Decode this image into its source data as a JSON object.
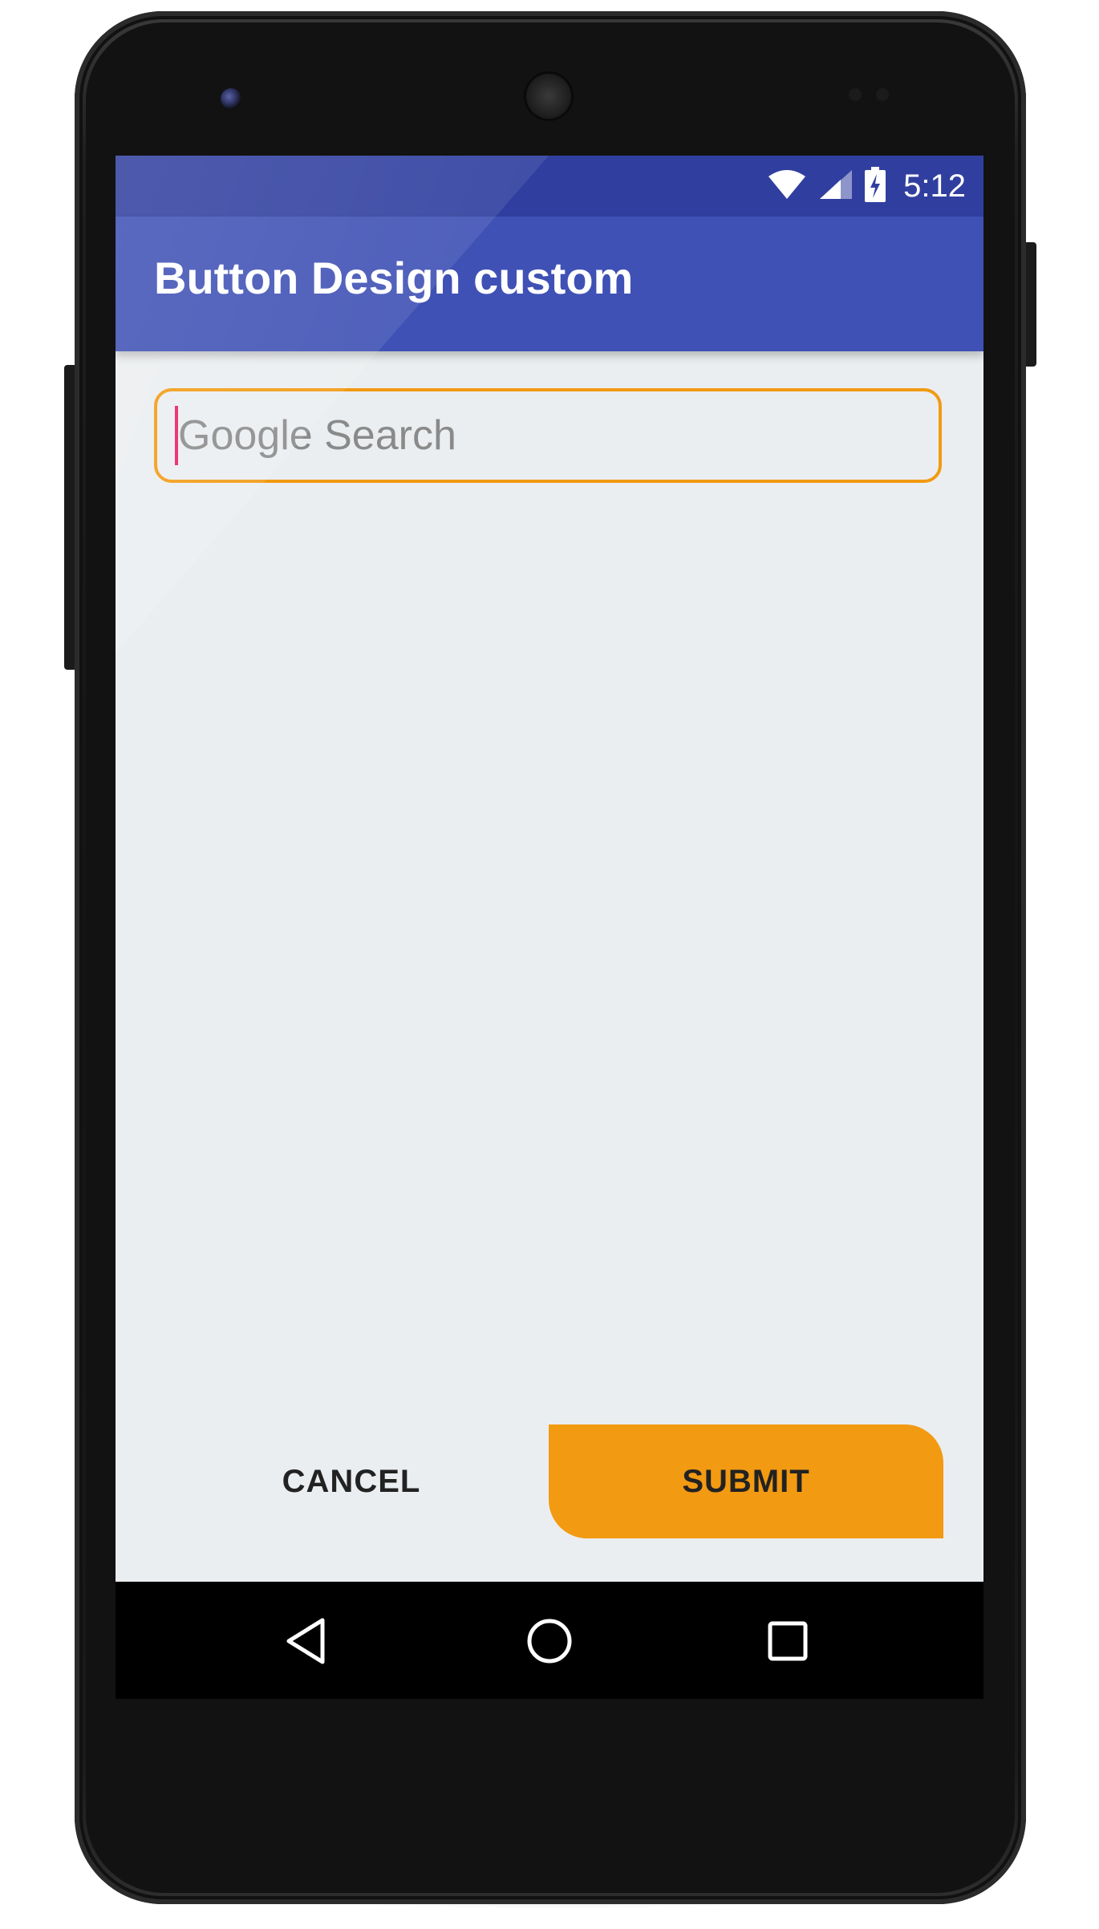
{
  "status_bar": {
    "time": "5:12",
    "icons": [
      "wifi-icon",
      "cell-signal-icon",
      "battery-charging-icon"
    ]
  },
  "app_bar": {
    "title": "Button Design custom"
  },
  "search": {
    "value": "",
    "placeholder": "Google Search"
  },
  "buttons": {
    "cancel_label": "CANCEL",
    "submit_label": "SUBMIT"
  },
  "nav_bar": {
    "icons": [
      "back-icon",
      "home-icon",
      "recents-icon"
    ]
  },
  "colors": {
    "status_bar": "#303f9f",
    "app_bar": "#3f51b5",
    "accent_orange": "#f29a12",
    "caret_pink": "#e91e63",
    "background": "#ebeef0"
  }
}
